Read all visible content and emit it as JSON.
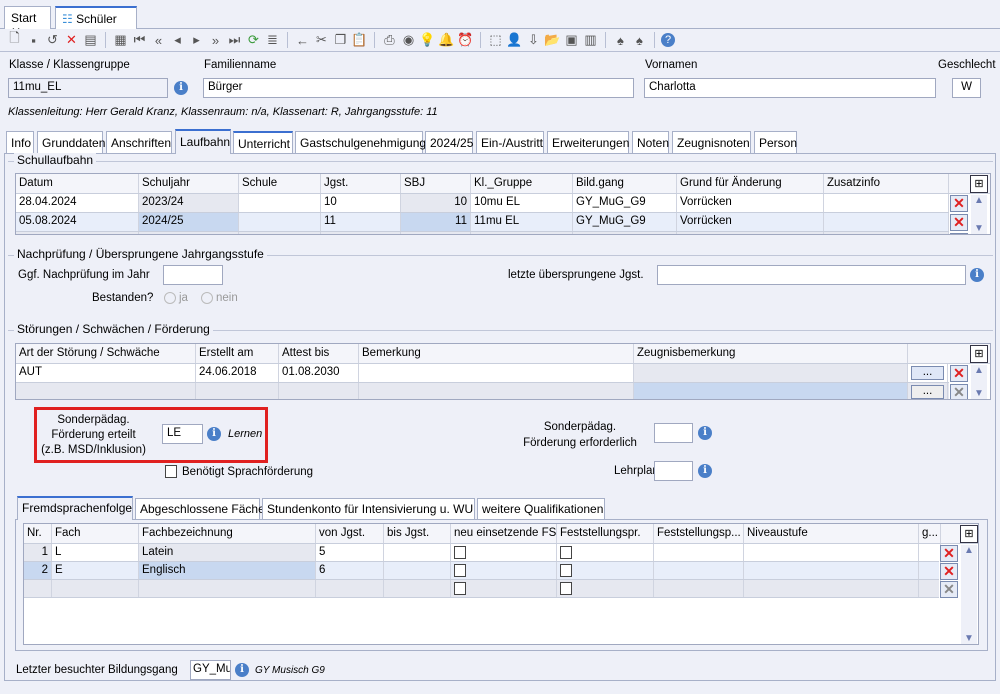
{
  "doc_tabs": [
    {
      "label": "Start",
      "close": "✕"
    },
    {
      "label": "Schüler",
      "close": "✕",
      "icon": "students-icon"
    }
  ],
  "header": {
    "klasse_label": "Klasse / Klassengruppe",
    "klasse_value": "11mu_EL",
    "familienname_label": "Familienname",
    "familienname_value": "Bürger",
    "vornamen_label": "Vornamen",
    "vornamen_value": "Charlotta",
    "geschlecht_label": "Geschlecht",
    "geschlecht_value": "W",
    "info_line": "Klassenleitung: Herr Gerald Kranz, Klassenraum: n/a, Klassenart: R, Jahrgangsstufe: 11"
  },
  "tabs": [
    "Info",
    "Grunddaten",
    "Anschriften",
    "Laufbahn",
    "Unterricht",
    "Gastschulgenehmigung",
    "2024/25",
    "Ein-/Austritt",
    "Erweiterungen",
    "Noten",
    "Zeugnisnoten",
    "Person"
  ],
  "active_tab": "Laufbahn",
  "schullaufbahn": {
    "title": "Schullaufbahn",
    "columns": [
      "Datum",
      "Schuljahr",
      "Schule",
      "Jgst.",
      "SBJ",
      "Kl._Gruppe",
      "Bild.gang",
      "Grund für Änderung",
      "Zusatzinfo"
    ],
    "rows": [
      [
        "28.04.2024",
        "2023/24",
        "",
        "10",
        "10",
        "10mu EL",
        "GY_MuG_G9",
        "Vorrücken",
        ""
      ],
      [
        "05.08.2024",
        "2024/25",
        "",
        "11",
        "11",
        "11mu EL",
        "GY_MuG_G9",
        "Vorrücken",
        ""
      ]
    ]
  },
  "nachpruefung": {
    "title": "Nachprüfung / Übersprungene Jahrgangsstufe",
    "jahr_label": "Ggf. Nachprüfung im Jahr",
    "jahr_value": "",
    "bestanden_label": "Bestanden?",
    "ja": "ja",
    "nein": "nein",
    "jgst_label": "letzte übersprungene Jgst.",
    "jgst_value": ""
  },
  "stoerungen": {
    "title": "Störungen / Schwächen / Förderung",
    "columns": [
      "Art der Störung / Schwäche",
      "Erstellt am",
      "Attest bis",
      "Bemerkung",
      "Zeugnisbemerkung"
    ],
    "rows": [
      [
        "AUT",
        "24.06.2018",
        "01.08.2030",
        "",
        ""
      ]
    ],
    "button": "..."
  },
  "foerderung": {
    "erteilt_label": [
      "Sonderpädag.",
      "Förderung erteilt",
      "(z.B. MSD/Inklusion)"
    ],
    "erteilt_value": "LE",
    "erteilt_text": "Lernen",
    "sprach_label": "Benötigt Sprachförderung",
    "erforderlich_label": [
      "Sonderpädag.",
      "Förderung erforderlich"
    ],
    "erforderlich_value": "",
    "lehrplan_label": "Lehrplan",
    "lehrplan_value": ""
  },
  "bottom_tabs": [
    "Fremdsprachenfolge",
    "Abgeschlossene Fächer",
    "Stundenkonto für Intensivierung u. WU",
    "weitere Qualifikationen"
  ],
  "fremdsprachen": {
    "columns": [
      "Nr.",
      "Fach",
      "Fachbezeichnung",
      "von Jgst.",
      "bis Jgst.",
      "neu einsetzende FS",
      "Feststellungspr.",
      "Feststellungsp...",
      "Niveaustufe",
      "g..."
    ],
    "rows": [
      [
        "1",
        "L",
        "Latein",
        "5",
        ""
      ],
      [
        "2",
        "E",
        "Englisch",
        "6",
        ""
      ]
    ]
  },
  "footer": {
    "label": "Letzter besuchter Bildungsgang",
    "value": "GY_Mu",
    "text": "GY Musisch G9"
  },
  "colors": {
    "accent": "#3b6fd0",
    "highlight_box": "#e02020",
    "selected_row": "#e8eefa"
  }
}
